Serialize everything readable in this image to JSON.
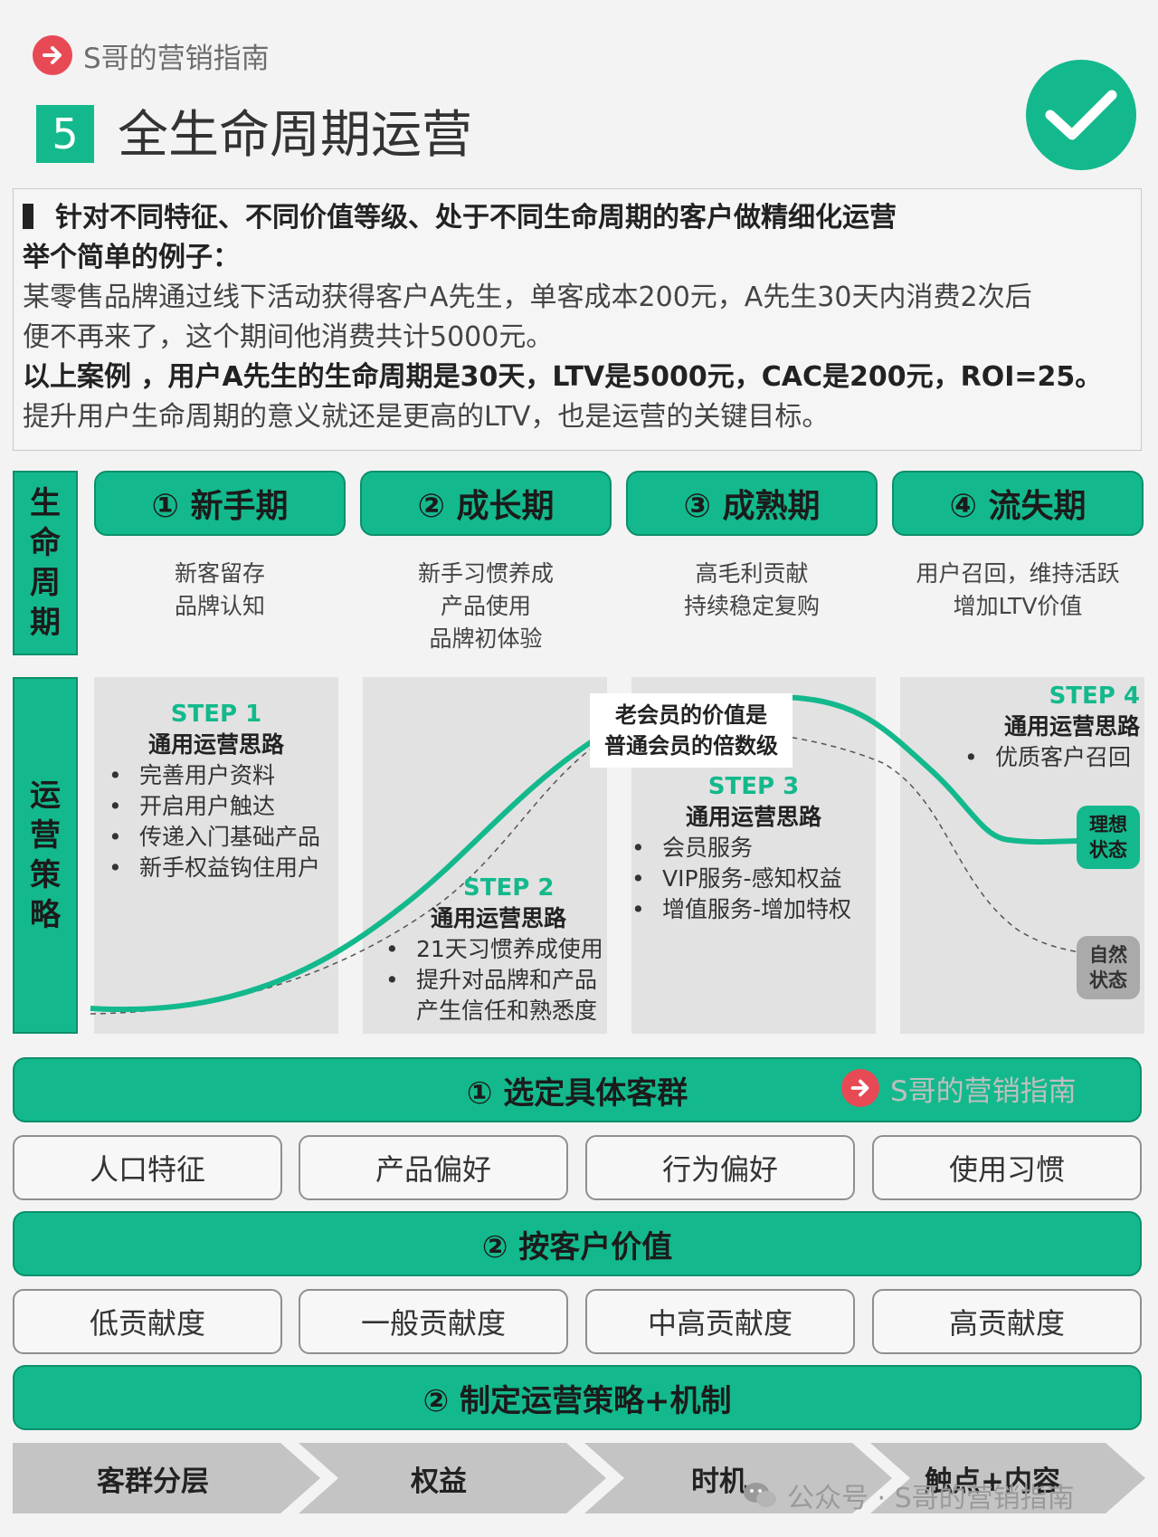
{
  "header": {
    "brand": "S哥的营销指南",
    "number": "5",
    "title": "全生命周期运营"
  },
  "intro": {
    "headline": "针对不同特征、不同价值等级、处于不同生命周期的客户做精细化运营",
    "example_label": "举个简单的例子：",
    "example_line1": "某零售品牌通过线下活动获得客户A先生，单客成本200元，A先生30天内消费2次后",
    "example_line2": "便不再来了，这个期间他消费共计5000元。",
    "conclusion": "以上案例 ，用户A先生的生命周期是30天，LTV是5000元，CAC是200元，ROI=25。",
    "meaning": "提升用户生命周期的意义就还是更高的LTV，也是运营的关键目标。"
  },
  "lifecycle": {
    "side_label": "生命周期",
    "phases": [
      {
        "label": "① 新手期",
        "desc": [
          "新客留存",
          "品牌认知"
        ]
      },
      {
        "label": "② 成长期",
        "desc": [
          "新手习惯养成",
          "产品使用",
          "品牌初体验"
        ]
      },
      {
        "label": "③ 成熟期",
        "desc": [
          "高毛利贡献",
          "持续稳定复购"
        ]
      },
      {
        "label": "④ 流失期",
        "desc": [
          "用户召回，维持活跃",
          "增加LTV价值"
        ]
      }
    ]
  },
  "strategy": {
    "side_label": "运营策略",
    "callout": [
      "老会员的价值是",
      "普通会员的倍数级"
    ],
    "ideal_state": [
      "理想",
      "状态"
    ],
    "natural_state": [
      "自然",
      "状态"
    ],
    "steps": [
      {
        "title": "STEP 1",
        "subtitle": "通用运营思路",
        "items": [
          "完善用户资料",
          "开启用户触达",
          "传递入门基础产品",
          "新手权益钩住用户"
        ]
      },
      {
        "title": "STEP 2",
        "subtitle": "通用运营思路",
        "items": [
          "21天习惯养成使用",
          "提升对品牌和产品",
          "产生信任和熟悉度"
        ]
      },
      {
        "title": "STEP  3",
        "subtitle": "通用运营思路",
        "items": [
          "会员服务",
          "VIP服务-感知权益",
          "增值服务-增加特权"
        ]
      },
      {
        "title": "STEP  4",
        "subtitle": "通用运营思路",
        "items": [
          "优质客户召回"
        ]
      }
    ]
  },
  "segments": {
    "bar": "① 选定具体客群",
    "items": [
      "人口特征",
      "产品偏好",
      "行为偏好",
      "使用习惯"
    ]
  },
  "value": {
    "bar": "② 按客户价值",
    "items": [
      "低贡献度",
      "一般贡献度",
      "中高贡献度",
      "高贡献度"
    ]
  },
  "mechanism": {
    "bar": "② 制定运营策略+机制",
    "items": [
      "客群分层",
      "权益",
      "时机",
      "触点+内容"
    ]
  },
  "footer": {
    "watermark": "公众号 · S哥的营销指南"
  },
  "colors": {
    "accent": "#13b98c",
    "brand_red": "#e84a55",
    "panel_gray": "#e2e2e2"
  }
}
